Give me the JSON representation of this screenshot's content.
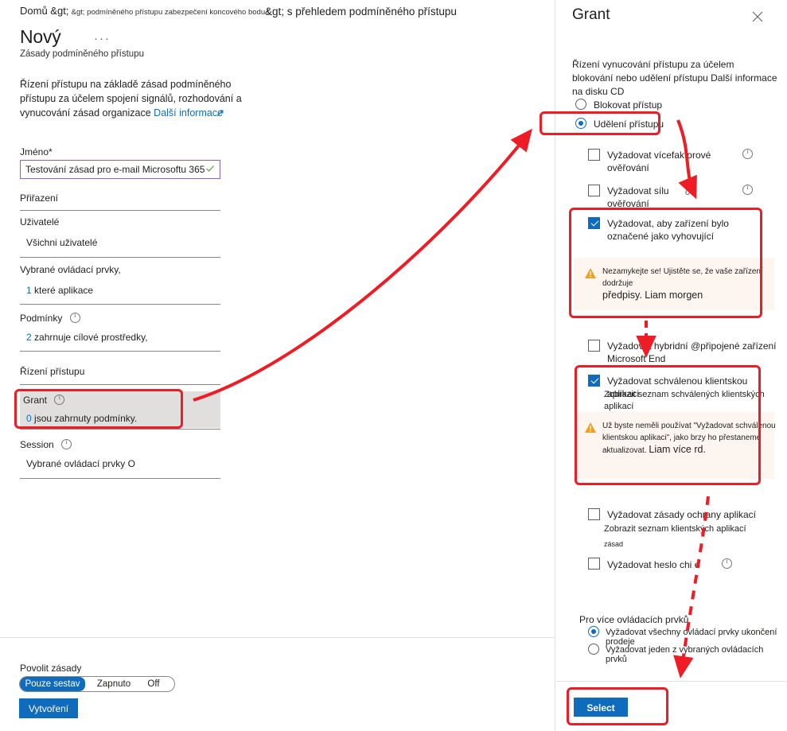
{
  "left": {
    "breadcrumb_home": "Domů &gt;",
    "breadcrumb_rest": "&gt; podmíněného přístupu zabezpečení koncového bodu l",
    "title": "Nový",
    "ellipsis": "···",
    "subtitle": "Zásady podmíněného přístupu",
    "intro": "Řízení přístupu na základě zásad podmíněného přístupu za účelem spojení signálů, rozhodování a vynucování zásad organizace",
    "intro_link": "Další informace",
    "name_label": "Jméno*",
    "name_value": "Testování zásad pro e-mail Microsoftu 365",
    "assignments_label": "Přiřazení",
    "users_label": "Uživatelé",
    "users_value": "Všichni uživatelé",
    "targets_label": "Vybrané ovládací prvky,",
    "targets_count": "1",
    "targets_value": "které aplikace",
    "conditions_label": "Podmínky",
    "conditions_count": "2",
    "conditions_value": "zahrnuje cílové prostředky,",
    "access_controls_label": "Řízení přístupu",
    "grant_label": "Grant",
    "grant_count": "0",
    "grant_value": "jsou zahrnuty podmínky.",
    "session_label": "Session",
    "session_value": "Vybrané ovládací prvky O",
    "enable_label": "Povolit zásady",
    "toggle_report_only": "Pouze sestav",
    "toggle_on": "Zapnuto",
    "toggle_off": "Off",
    "create_button": "Vytvoření"
  },
  "mid_caption": "&gt; s přehledem podmíněného přístupu",
  "panel": {
    "title": "Grant",
    "close_icon": "close-icon",
    "description": "Řízení vynucování přístupu za účelem blokování nebo udělení přístupu Další informace na disku CD",
    "radio_block": "Blokovat přístup",
    "radio_grant": "Udělení přístupu",
    "checkboxes": [
      {
        "label": "Vyžadovat vícefaktorové ověřování",
        "checked": false,
        "info": true
      },
      {
        "label": "Vyžadovat sílu ověřování",
        "checked": false,
        "info": true,
        "extra": "o"
      },
      {
        "label": "Vyžadovat, aby zařízení bylo označené jako vyhovující",
        "checked": true,
        "warning": "Nezamykejte se! Ujistěte se, že vaše zařízení dodržuje",
        "warning_big": "předpisy. Liam morgen"
      },
      {
        "label": "Vyžadovat hybridní @připojené zařízení Microsoft End",
        "checked": false
      },
      {
        "label": "Vyžadovat schválenou klientskou aplikaci",
        "checked": true,
        "sublink": "Zobrazit seznam schválených klientských aplikací",
        "warning": "Už byste neměli používat \"Vyžadovat schválenou klientskou aplikaci\", jako brzy ho přestaneme aktualizovat.",
        "warning_big": "Liam více rd."
      },
      {
        "label": "Vyžadovat zásady ochrany aplikací",
        "checked": false,
        "sublink": "Zobrazit seznam klientských aplikací",
        "sublink2": "zásad"
      },
      {
        "label": "Vyžadovat heslo chi e",
        "checked": false,
        "info": true
      }
    ],
    "multi_label": "Pro více ovládacích prvků",
    "multi_option_all": "Vyžadovat všechny ovládací prvky ukončení prodeje",
    "multi_option_one": "Vyžadovat jeden z vybraných ovládacích prvků",
    "select_button": "Select"
  },
  "colors": {
    "accent": "#0f6cbd",
    "annotation": "#ee1c25",
    "warning": "#f0a020",
    "input_border": "#8764b8",
    "highlight_row": "#e1dfdd"
  }
}
